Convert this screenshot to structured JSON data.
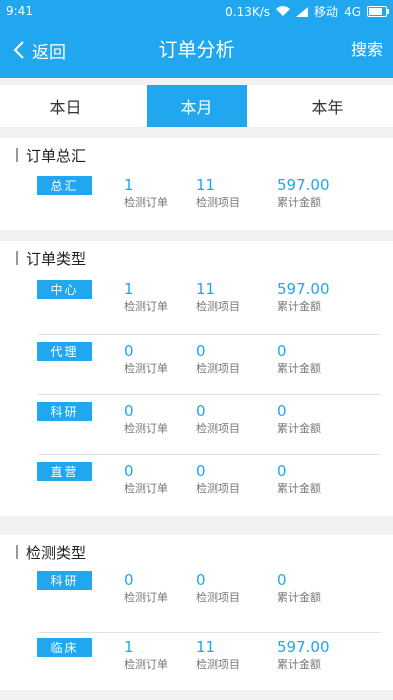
{
  "statusbar": {
    "time": "9:41",
    "speed": "0.13K/s",
    "carrier": "移动",
    "network": "4G"
  },
  "header": {
    "back_label": "返回",
    "title": "订单分析",
    "search_label": "搜索"
  },
  "tabs": [
    {
      "label": "本日"
    },
    {
      "label": "本月",
      "active": true
    },
    {
      "label": "本年"
    }
  ],
  "stat_labels": {
    "orders": "检测订单",
    "items": "检测项目",
    "amount": "累计金额"
  },
  "sections": [
    {
      "title": "订单总汇",
      "rows": [
        {
          "tag": "总汇",
          "orders": "1",
          "items": "11",
          "amount": "597.00"
        }
      ]
    },
    {
      "title": "订单类型",
      "rows": [
        {
          "tag": "中心",
          "orders": "1",
          "items": "11",
          "amount": "597.00"
        },
        {
          "tag": "代理",
          "orders": "0",
          "items": "0",
          "amount": "0"
        },
        {
          "tag": "科研",
          "orders": "0",
          "items": "0",
          "amount": "0"
        },
        {
          "tag": "直营",
          "orders": "0",
          "items": "0",
          "amount": "0"
        }
      ]
    },
    {
      "title": "检测类型",
      "rows": [
        {
          "tag": "科研",
          "orders": "0",
          "items": "0",
          "amount": "0"
        },
        {
          "tag": "临床",
          "orders": "1",
          "items": "11",
          "amount": "597.00"
        }
      ]
    }
  ]
}
